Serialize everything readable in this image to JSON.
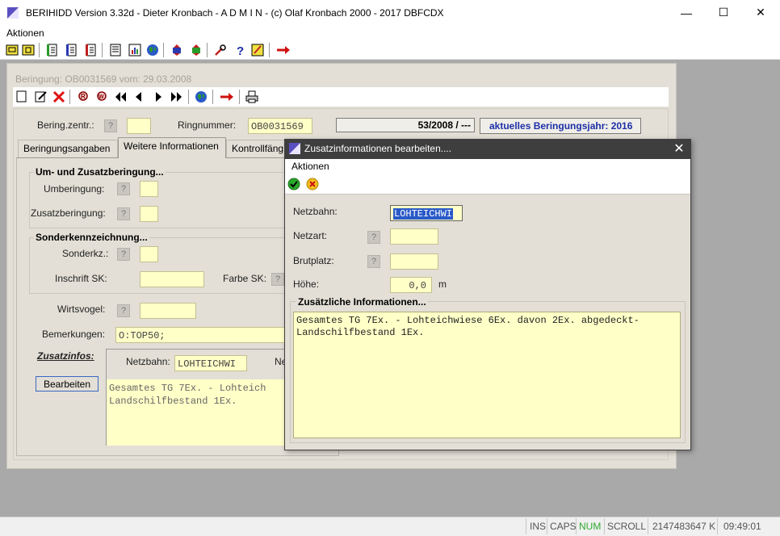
{
  "app": {
    "title": "BERIHIDD Version 3.32d - Dieter Kronbach - A D M I N - (c) Olaf Kronbach 2000 - 2017  DBFCDX",
    "menu": [
      "Aktionen"
    ]
  },
  "window_controls": {
    "minimize": "—",
    "maximize": "☐",
    "close": "✕"
  },
  "toolbar": {
    "icons": [
      "card-icon",
      "card2-icon",
      "list-green-icon",
      "list-blue-icon",
      "list-red-icon",
      "document-icon",
      "chart-icon",
      "globe-icon",
      "transfer-blue-icon",
      "transfer-green-icon",
      "tools-icon",
      "help-icon",
      "edit-icon",
      "exit-arrow-icon"
    ]
  },
  "beringung": {
    "title": "Beringung: OB0031569 vom: 29.03.2008",
    "toolbar_icons": [
      "new-icon",
      "edit-icon",
      "delete-icon",
      "search-icon",
      "search-replace-icon",
      "first-icon",
      "prev-icon",
      "next-icon",
      "last-icon",
      "globe-icon",
      "exit-arrow-icon",
      "print-icon"
    ],
    "ber_zentr_label": "Bering.zentr.:",
    "ber_zentr_value": "",
    "ringnummer_label": "Ringnummer:",
    "ringnummer_value": "OB0031569",
    "record_position": "53/2008 / ---",
    "beringungsjahr": "aktuelles Beringungsjahr: 2016",
    "tabs": [
      "Beringungsangaben",
      "Weitere Informationen",
      "Kontrollfäng"
    ],
    "active_tab": 1,
    "um_zusatz_group": "Um- und Zusatzberingung...",
    "umberingung_label": "Umberingung:",
    "umberingung_value": "",
    "zusatzberingung_label": "Zusatzberingung:",
    "zusatzberingung_value": "",
    "sonder_group": "Sonderkennzeichnung...",
    "sonderkz_label": "Sonderkz.:",
    "sonderkz_value": "",
    "inschrift_label": "Inschrift SK:",
    "inschrift_value": "",
    "farbe_label": "Farbe SK:",
    "wirtsvogel_label": "Wirtsvogel:",
    "wirtsvogel_value": "",
    "bemerkungen_label": "Bemerkungen:",
    "bemerkungen_value": "O:TOP50;",
    "zusatzinfos_label": "Zusatzinfos:",
    "bearbeiten_label": "Bearbeiten",
    "netzbahn_label": "Netzbahn:",
    "netzbahn_value": "LOHTEICHWI",
    "netz_truncated_label": "Ne",
    "notes_preview": "Gesamtes TG 7Ex. - Lohteich\nLandschilfbestand 1Ex."
  },
  "dialog": {
    "title": "Zusatzinformationen bearbeiten....",
    "close": "✕",
    "menu": "Aktionen",
    "netzbahn_label": "Netzbahn:",
    "netzbahn_value": "LOHTEICHWI",
    "netzart_label": "Netzart:",
    "netzart_value": "",
    "brutplatz_label": "Brutplatz:",
    "brutplatz_value": "",
    "hoehe_label": "Höhe:",
    "hoehe_value": "0,0",
    "hoehe_unit": "m",
    "notes_group": "Zusätzliche Informationen...",
    "notes": "Gesamtes TG 7Ex. - Lohteichwiese 6Ex. davon 2Ex. abgedeckt-\nLandschilfbestand 1Ex."
  },
  "help_btn": "?",
  "statusbar": {
    "ins": "INS",
    "caps": "CAPS",
    "num": "NUM",
    "scroll": "SCROLL",
    "memory": "2147483647 K",
    "time": "09:49:01"
  },
  "colors": {
    "field_bg": "#ffffc8",
    "dialog_title_bg": "#3e3e3e",
    "num_active": "#2fa82f",
    "year_text": "#1c2fa8"
  }
}
